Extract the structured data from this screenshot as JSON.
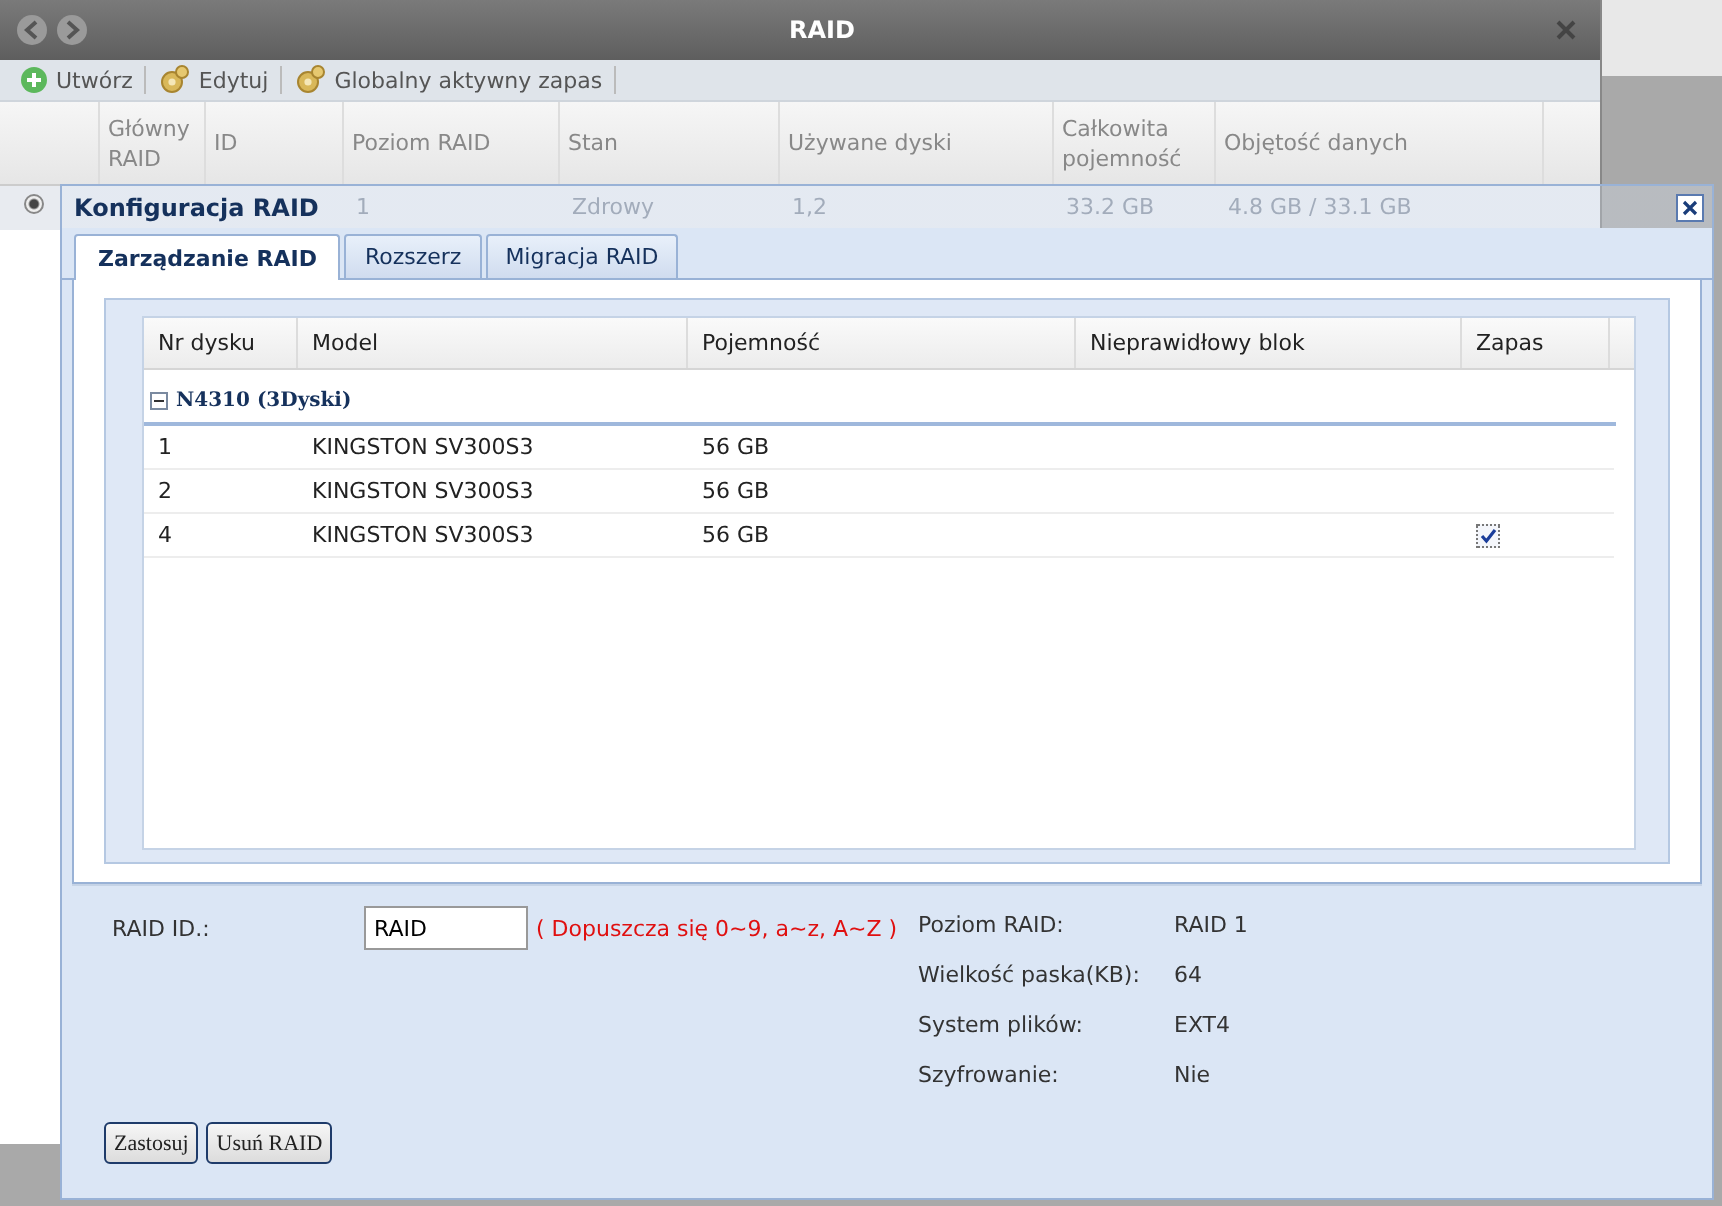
{
  "window": {
    "title": "RAID"
  },
  "toolbar": [
    {
      "kind": "add",
      "label": "Utwórz"
    },
    {
      "kind": "gear",
      "label": "Edytuj"
    },
    {
      "kind": "gear",
      "label": "Globalny aktywny zapas"
    }
  ],
  "raid_table": {
    "columns": [
      "Główny RAID",
      "ID",
      "Poziom RAID",
      "Stan",
      "Używane dyski",
      "Całkowita pojemność",
      "Objętość danych"
    ],
    "rows": [
      {
        "selected": true,
        "cells": [
          "",
          "",
          "1",
          "Zdrowy",
          "1,2",
          "33.2 GB",
          "4.8 GB / 33.1 GB"
        ]
      }
    ]
  },
  "dialog": {
    "title": "Konfiguracja RAID",
    "tabs": [
      {
        "label": "Zarządzanie RAID",
        "selected": true
      },
      {
        "label": "Rozszerz",
        "selected": false
      },
      {
        "label": "Migracja RAID",
        "selected": false
      }
    ],
    "disk_table": {
      "columns": [
        "Nr dysku",
        "Model",
        "Pojemność",
        "Nieprawidłowy blok",
        "Zapas"
      ],
      "group": {
        "label": "N4310 (3Dyski)",
        "expanded": true
      },
      "rows": [
        {
          "cells": [
            "1",
            "KINGSTON SV300S3",
            "56 GB",
            ""
          ],
          "spare": false
        },
        {
          "cells": [
            "2",
            "KINGSTON SV300S3",
            "56 GB",
            ""
          ],
          "spare": false
        },
        {
          "cells": [
            "4",
            "KINGSTON SV300S3",
            "56 GB",
            ""
          ],
          "spare": true
        }
      ]
    },
    "raid_id": {
      "label": "RAID ID.:",
      "value": "RAID",
      "hint": "( Dopuszcza się 0~9, a~z, A~Z )"
    },
    "info": [
      {
        "label": "Poziom RAID:",
        "value": "RAID 1"
      },
      {
        "label": "Wielkość paska(KB):",
        "value": "64"
      },
      {
        "label": "System plików:",
        "value": "EXT4"
      },
      {
        "label": "Szyfrowanie:",
        "value": "Nie"
      }
    ],
    "buttons": [
      "Zastosuj",
      "Usuń RAID"
    ]
  }
}
